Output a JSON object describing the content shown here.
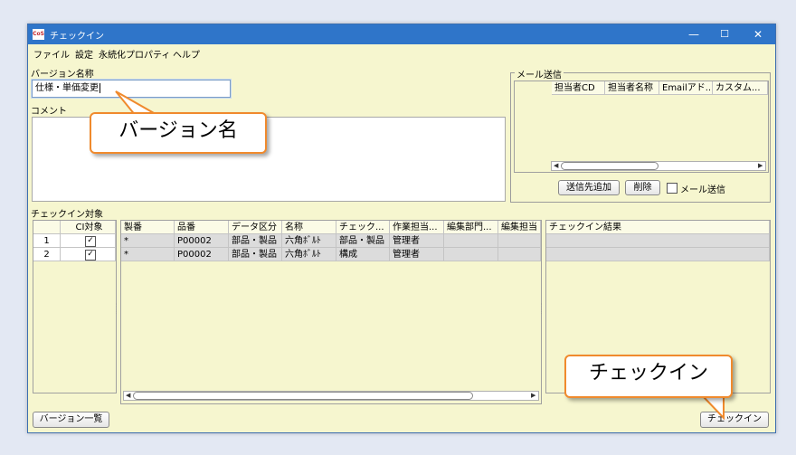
{
  "window": {
    "title": "チェックイン",
    "icon_text": "CoS",
    "minimize": "—",
    "maximize": "☐",
    "close": "✕"
  },
  "menu": {
    "items": [
      "ファイル",
      "設定",
      "永続化プロパティ",
      "ヘルプ"
    ]
  },
  "version": {
    "label": "バージョン名称",
    "value": "仕様・単価変更"
  },
  "comment": {
    "label": "コメント",
    "value": ""
  },
  "mail": {
    "legend": "メール送信",
    "columns": [
      "担当者CD",
      "担当者名称",
      "Emailアド...",
      "カスタム..."
    ],
    "add_button": "送信先追加",
    "delete_button": "削除",
    "checkbox_label": "メール送信",
    "checked": false
  },
  "checkin_targets": {
    "label": "チェックイン対象",
    "left_columns": [
      "",
      "CI対象"
    ],
    "left_rows": [
      {
        "num": "1",
        "checked": true
      },
      {
        "num": "2",
        "checked": true
      }
    ],
    "columns": [
      "製番",
      "品番",
      "データ区分",
      "名称",
      "チェック...",
      "作業担当...",
      "編集部門...",
      "編集担当"
    ],
    "rows": [
      [
        "*",
        "P00002",
        "部品・製品",
        "六角ﾎﾞﾙﾄ",
        "部品・製品",
        "管理者",
        "",
        ""
      ],
      [
        "*",
        "P00002",
        "部品・製品",
        "六角ﾎﾞﾙﾄ",
        "構成",
        "管理者",
        "",
        ""
      ]
    ],
    "result_column": "チェックイン結果"
  },
  "buttons": {
    "version_list": "バージョン一覧",
    "checkin": "チェックイン"
  },
  "callouts": {
    "version_name": "バージョン名",
    "checkin": "チェックイン"
  },
  "colors": {
    "accent": "#2f75c9",
    "window_bg": "#f6f6cf",
    "callout_border": "#f08a2d"
  }
}
